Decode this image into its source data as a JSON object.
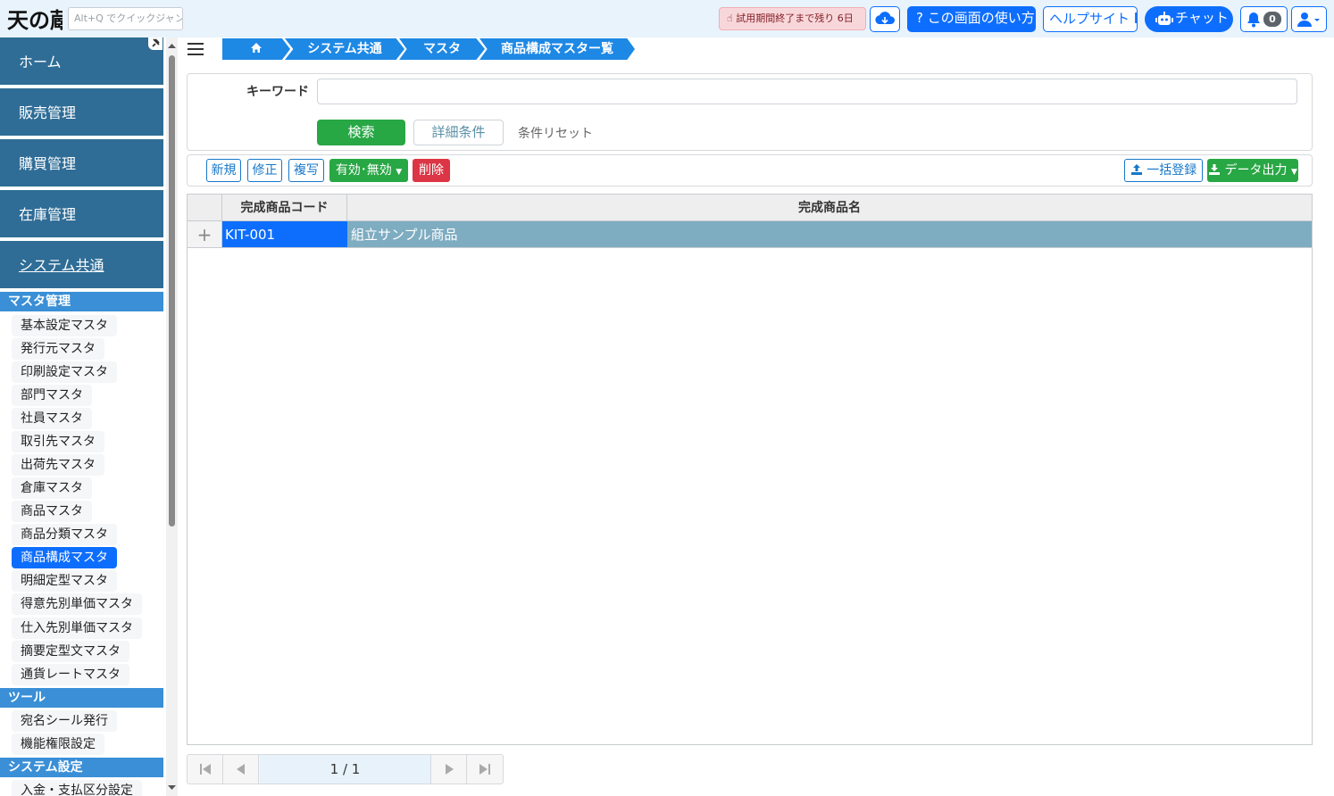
{
  "header": {
    "logo_text": "天の蔵",
    "quick_jump_placeholder": "Alt+Q でクイックジャンプ",
    "trial_notice": "試用期間終了まで残り 6日",
    "howto_label": "この画面の使い方",
    "help_label": "ヘルプサイト",
    "chat_label": "チャット",
    "notification_count": "0"
  },
  "sidebar": {
    "main_items": [
      {
        "label": "ホーム"
      },
      {
        "label": "販売管理"
      },
      {
        "label": "購買管理"
      },
      {
        "label": "在庫管理"
      },
      {
        "label": "システム共通"
      }
    ],
    "sections": [
      {
        "title": "マスタ管理",
        "items": [
          "基本設定マスタ",
          "発行元マスタ",
          "印刷設定マスタ",
          "部門マスタ",
          "社員マスタ",
          "取引先マスタ",
          "出荷先マスタ",
          "倉庫マスタ",
          "商品マスタ",
          "商品分類マスタ",
          "商品構成マスタ",
          "明細定型マスタ",
          "得意先別単価マスタ",
          "仕入先別単価マスタ",
          "摘要定型文マスタ",
          "通貨レートマスタ"
        ]
      },
      {
        "title": "ツール",
        "items": [
          "宛名シール発行",
          "機能権限設定"
        ]
      },
      {
        "title": "システム設定",
        "items": [
          "入金・支払区分設定"
        ]
      }
    ],
    "active_item": "商品構成マスタ"
  },
  "breadcrumb": [
    "システム共通",
    "マスタ",
    "商品構成マスター覧"
  ],
  "search": {
    "keyword_label": "キーワード",
    "keyword_value": "",
    "search_button": "検索",
    "detail_button": "詳細条件",
    "reset_link": "条件リセット"
  },
  "toolbar": {
    "new": "新規",
    "edit": "修正",
    "copy": "複写",
    "valid_toggle": "有効･無効",
    "delete": "削除",
    "bulk_register": "一括登録",
    "data_export": "データ出力"
  },
  "grid": {
    "columns": [
      "完成商品コード",
      "完成商品名"
    ],
    "rows": [
      {
        "code": "KIT-001",
        "name": "組立サンプル商品"
      }
    ]
  },
  "pager": {
    "page_info": "1 / 1"
  },
  "colors": {
    "primary": "#0d6efd",
    "sidebar_bg": "#2f6d96",
    "section_head": "#3a8fd6",
    "success": "#28a745",
    "danger": "#dc3545"
  }
}
